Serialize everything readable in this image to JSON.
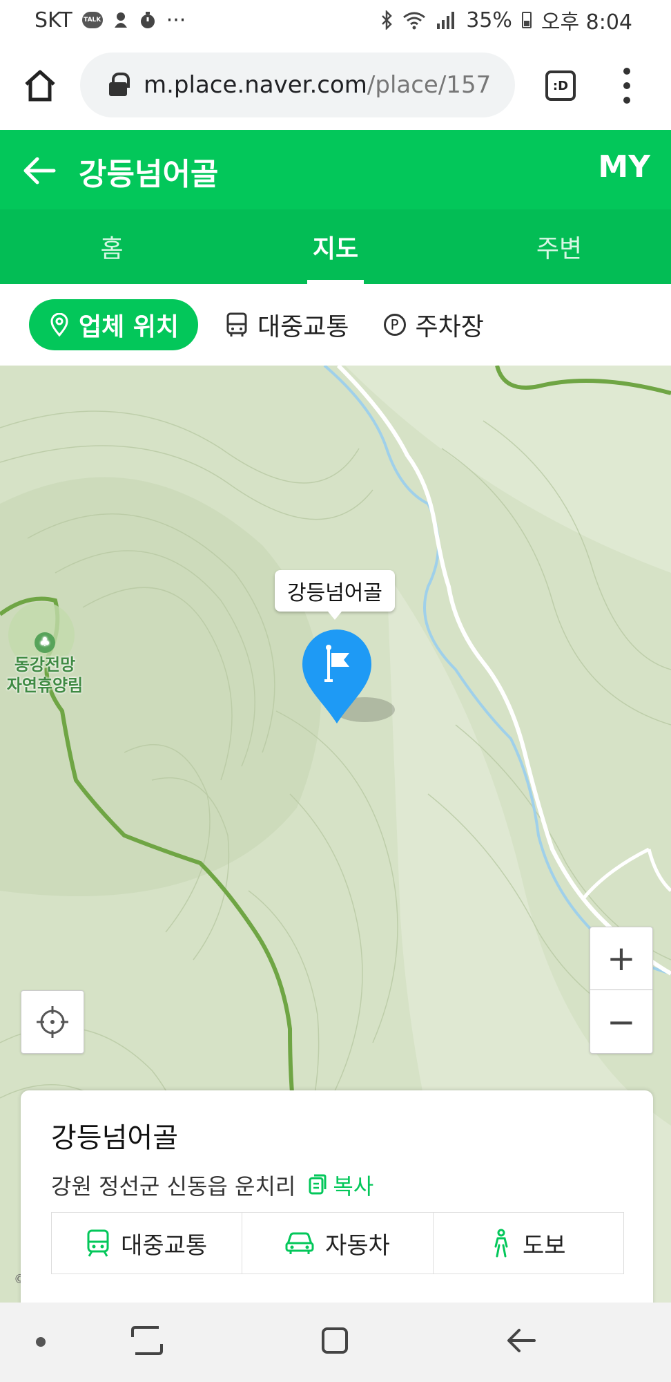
{
  "status_bar": {
    "carrier": "SKT",
    "talk_badge": "TALK",
    "more": "···",
    "battery": "35%",
    "time": "오후 8:04"
  },
  "browser": {
    "url_host": "m.place.naver.com",
    "url_path": "/place/157",
    "tab_switcher": ":D"
  },
  "header": {
    "title": "강등넘어골",
    "my": "MY"
  },
  "tabs": [
    {
      "label": "홈"
    },
    {
      "label": "지도",
      "active": true
    },
    {
      "label": "주변"
    }
  ],
  "subtabs": {
    "location": "업체 위치",
    "transit": "대중교통",
    "parking": "주차장"
  },
  "map": {
    "pin_label": "강등넘어골",
    "poi_line1": "동강전망",
    "poi_line2": "자연휴양림",
    "zoom_in": "+",
    "zoom_out": "−",
    "copyright": "©",
    "colors": {
      "base": "#d6e2c6",
      "road_green": "#6fa544",
      "river": "#9fd0ea",
      "pin": "#1e9af5"
    }
  },
  "card": {
    "title": "강등넘어골",
    "address": "강원 정선군 신동읍 운치리",
    "copy": "복사",
    "routes": {
      "transit": "대중교통",
      "car": "자동차",
      "walk": "도보"
    }
  },
  "icons": [
    "home-icon",
    "lock-icon",
    "kebab-menu-icon",
    "back-arrow-icon",
    "location-pin-icon",
    "bus-icon",
    "parking-icon",
    "flag-pin-icon",
    "locate-icon",
    "copy-icon",
    "train-icon",
    "car-icon",
    "walk-icon"
  ]
}
